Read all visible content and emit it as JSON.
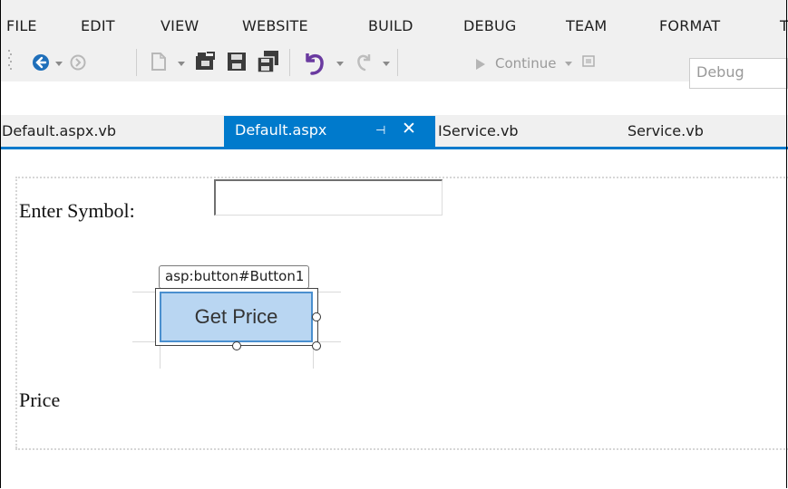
{
  "menubar": {
    "items": [
      "FILE",
      "EDIT",
      "VIEW",
      "WEBSITE",
      "BUILD",
      "DEBUG",
      "TEAM",
      "FORMAT",
      "T"
    ]
  },
  "toolbar": {
    "icons": [
      "back-icon",
      "forward-icon",
      "new-project-icon",
      "open-file-icon",
      "save-icon",
      "save-all-icon",
      "undo-icon",
      "redo-icon"
    ],
    "continue_label": "Continue",
    "config_value": "Debug"
  },
  "tabs": [
    {
      "label": "Default.aspx.vb",
      "active": false
    },
    {
      "label": "Default.aspx",
      "active": true
    },
    {
      "label": "IService.vb",
      "active": false
    },
    {
      "label": "Service.vb",
      "active": false
    }
  ],
  "design": {
    "enter_symbol_label": "Enter Symbol:",
    "symbol_value": "",
    "button_tag": "asp:button#Button1",
    "button_label": "Get Price",
    "price_label": "Price"
  },
  "colors": {
    "accent": "#007acc",
    "chrome_bg": "#f0f0f0",
    "button_fill": "#b9d6f2",
    "toolbar_blue": "#1f6fba",
    "icon_dark": "#3c3c3c",
    "undo_purple": "#6a3aa0"
  }
}
